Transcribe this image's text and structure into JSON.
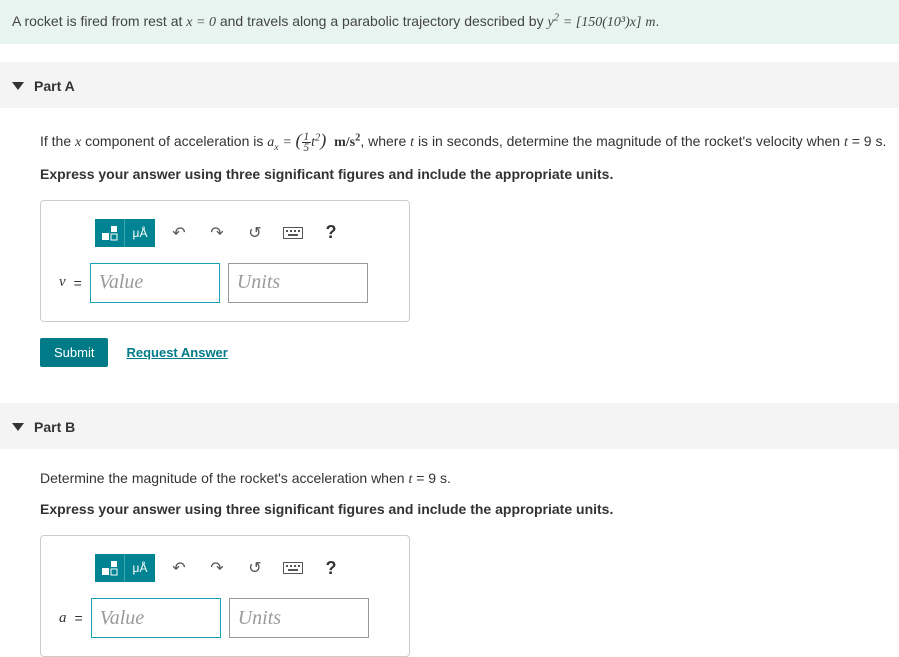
{
  "problem": {
    "prefix": "A rocket is fired from rest at ",
    "eq1": "x = 0",
    "mid1": " and travels along a parabolic trajectory described by ",
    "eq2_lhs": "y",
    "eq2_sup": "2",
    "eq2_eq": " = ",
    "eq2_rhs": "[150(10³)x]",
    "unit": " m",
    "suffix": "."
  },
  "partA": {
    "title": "Part A",
    "q_prefix": "If the ",
    "q_var1": "x",
    "q_mid1": " component of acceleration is ",
    "q_ax": "a",
    "q_ax_sub": "x",
    "q_eq": " = ",
    "q_frac_num": "1",
    "q_frac_den": "5",
    "q_t": "t",
    "q_t_sup": "2",
    "q_units1": "m/s",
    "q_units1_sup": "2",
    "q_mid2": ", where ",
    "q_var2": "t",
    "q_mid3": " is in seconds, determine the magnitude of the rocket's velocity when ",
    "q_var3": "t",
    "q_tval": " = 9 s.",
    "instruction": "Express your answer using three significant figures and include the appropriate units.",
    "var_label": "v",
    "eq_sign": "=",
    "value_ph": "Value",
    "units_ph": "Units",
    "submit": "Submit",
    "request": "Request Answer"
  },
  "partB": {
    "title": "Part B",
    "q_prefix": "Determine the magnitude of the rocket's acceleration when ",
    "q_var": "t",
    "q_tval": " = 9 s.",
    "instruction": "Express your answer using three significant figures and include the appropriate units.",
    "var_label": "a",
    "eq_sign": "=",
    "value_ph": "Value",
    "units_ph": "Units"
  },
  "toolbar": {
    "microA": "μÅ"
  }
}
